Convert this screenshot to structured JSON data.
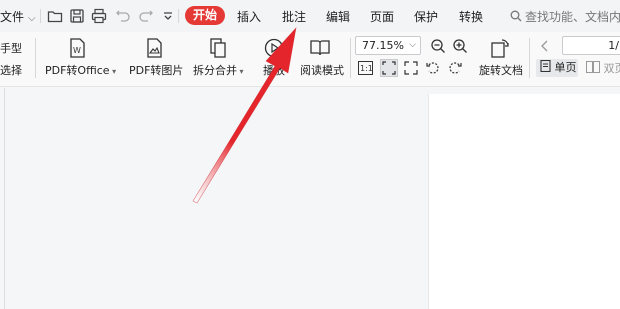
{
  "menubar": {
    "file_label": "文件",
    "tabs": {
      "start": "开始",
      "insert": "插入",
      "annotate": "批注",
      "edit": "编辑",
      "page": "页面",
      "protect": "保护",
      "convert": "转换"
    },
    "search_placeholder": "查找功能、文档内容"
  },
  "ribbon": {
    "hand_tool": "手型",
    "select_tool": "选择",
    "pdf_to_office": "PDF转Office",
    "pdf_to_image": "PDF转图片",
    "split_merge": "拆分合并",
    "play": "播放",
    "read_mode": "阅读模式",
    "zoom_value": "77.15%",
    "rotate_doc": "旋转文档",
    "page_number": "1/",
    "single_page": "单页",
    "double_page": "双页"
  },
  "colors": {
    "accent_red": "#e53935",
    "arrow_red": "#e4252b"
  }
}
